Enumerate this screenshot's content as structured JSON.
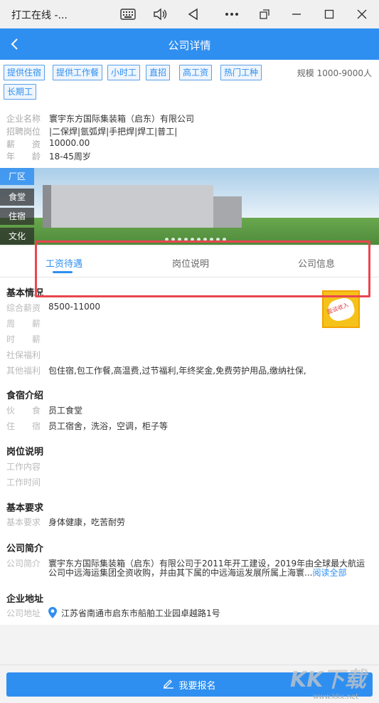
{
  "window": {
    "title": "打工在线 -..."
  },
  "header": {
    "title": "公司详情"
  },
  "tags": [
    "提供住宿",
    "提供工作餐",
    "小时工",
    "直招",
    "高工资",
    "热门工种",
    "长期工"
  ],
  "scale": "规模 1000-9000人",
  "company": {
    "name_label": "企业名称",
    "name": "寰宇东方国际集装箱（启东）有限公司",
    "positions_label": "招聘岗位",
    "positions": "|二保焊|氩弧焊|手把焊|焊工|普工|",
    "salary_label": "薪　　资",
    "salary": "10000.00",
    "age_label": "年　　龄",
    "age": "18-45周岁"
  },
  "banner": {
    "side_tabs": [
      "厂区",
      "食堂",
      "住宿",
      "文化"
    ]
  },
  "tabs": [
    "工资待遇",
    "岗位说明",
    "公司信息"
  ],
  "badge_text": "面谈收入",
  "sections": {
    "basic": {
      "title": "基本情况",
      "rows": [
        {
          "label": "综合薪资",
          "value": "8500-11000"
        },
        {
          "label": "周　　薪",
          "value": ""
        },
        {
          "label": "时　　薪",
          "value": ""
        },
        {
          "label": "社保福利",
          "value": ""
        },
        {
          "label": "其他福利",
          "value": "包住宿,包工作餐,高温费,过节福利,年终奖金,免费劳护用品,缴纳社保,"
        }
      ]
    },
    "food": {
      "title": "食宿介绍",
      "rows": [
        {
          "label": "伙　　食",
          "value": "员工食堂"
        },
        {
          "label": "住　　宿",
          "value": "员工宿舍，洗浴，空调，柜子等"
        }
      ]
    },
    "job": {
      "title": "岗位说明",
      "rows": [
        {
          "label": "工作内容",
          "value": ""
        },
        {
          "label": "工作时间",
          "value": ""
        }
      ]
    },
    "req": {
      "title": "基本要求",
      "rows": [
        {
          "label": "基本要求",
          "value": "身体健康，吃苦耐劳"
        }
      ]
    },
    "intro": {
      "title": "公司简介",
      "label": "公司简介",
      "line1": "寰宇东方国际集装箱（启东）有限公司于2011年开工建设，2019年由全球最大航运",
      "line2": "公司中远海运集团全资收购，并由其下属的中远海运发展所属上海寰...",
      "read_all": "阅读全部"
    },
    "address": {
      "title": "企业地址",
      "label": "公司地址",
      "value": "江苏省南通市启东市船舶工业园卓越路1号"
    }
  },
  "apply": {
    "label": "我要报名"
  },
  "watermark": {
    "logo": "KK下载",
    "url": "www.kkx.net"
  },
  "colors": {
    "primary": "#2f8ff0",
    "highlight": "#e9464f"
  }
}
